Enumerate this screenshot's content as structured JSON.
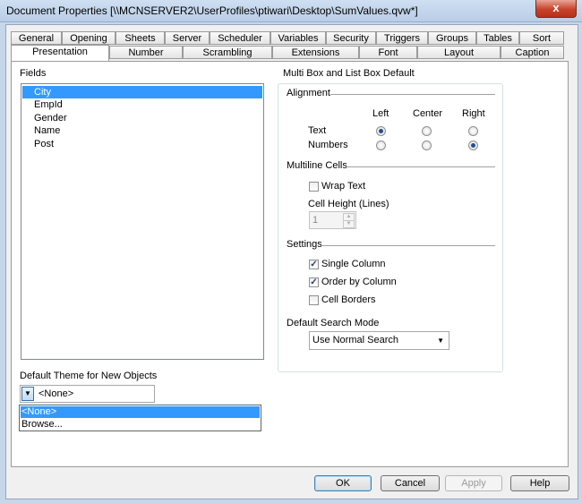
{
  "window": {
    "title": "Document Properties [\\\\MCNSERVER2\\UserProfiles\\ptiwari\\Desktop\\SumValues.qvw*]",
    "close_symbol": "x"
  },
  "tabs_row1": [
    "General",
    "Opening",
    "Sheets",
    "Server",
    "Scheduler",
    "Variables",
    "Security",
    "Triggers",
    "Groups",
    "Tables",
    "Sort"
  ],
  "tabs_row2": [
    "Presentation",
    "Number",
    "Scrambling",
    "Extensions",
    "Font",
    "Layout",
    "Caption"
  ],
  "active_tab": "Presentation",
  "fields": {
    "label": "Fields",
    "items": [
      "City",
      "EmpId",
      "Gender",
      "Name",
      "Post"
    ],
    "selected": "City"
  },
  "multibox": {
    "group_label": "Multi Box and List Box Default",
    "alignment": {
      "label": "Alignment",
      "columns": [
        "Left",
        "Center",
        "Right"
      ],
      "rows": [
        {
          "label": "Text",
          "selected": "Left"
        },
        {
          "label": "Numbers",
          "selected": "Right"
        }
      ]
    },
    "multiline": {
      "label": "Multiline Cells",
      "wrap_text": {
        "label": "Wrap Text",
        "checked": false
      },
      "cell_height_label": "Cell Height (Lines)",
      "cell_height_value": "1"
    },
    "settings": {
      "label": "Settings",
      "single_column": {
        "label": "Single Column",
        "checked": true
      },
      "order_by_column": {
        "label": "Order by Column",
        "checked": true
      },
      "cell_borders": {
        "label": "Cell Borders",
        "checked": false
      }
    },
    "search_mode": {
      "label": "Default Search Mode",
      "value": "Use Normal Search"
    }
  },
  "theme": {
    "label": "Default Theme for New Objects",
    "value": "<None>",
    "options": [
      "<None>",
      "Browse..."
    ],
    "highlighted": "<None>"
  },
  "buttons": {
    "ok": "OK",
    "cancel": "Cancel",
    "apply": "Apply",
    "help": "Help"
  },
  "colors": {
    "selection": "#3399ff",
    "titlebar": "#c6d7ec",
    "close": "#c7432b"
  }
}
